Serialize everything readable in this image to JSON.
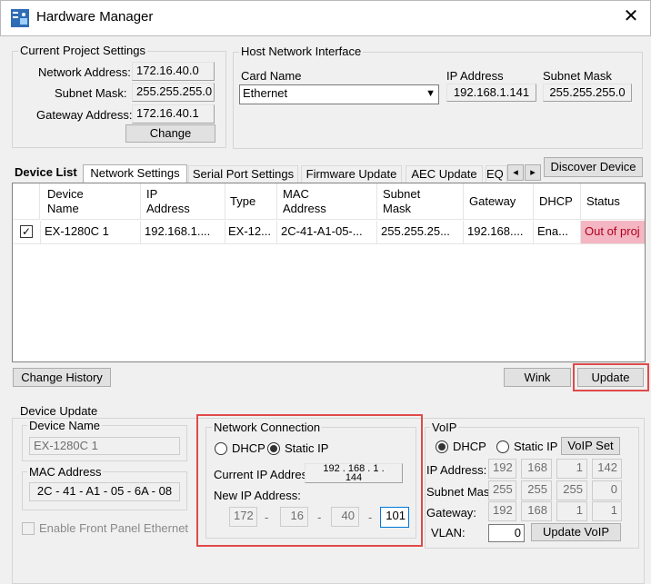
{
  "window": {
    "title": "Hardware Manager",
    "close_glyph": "✕"
  },
  "project_settings": {
    "title": "Current Project Settings",
    "network_address_label": "Network Address:",
    "network_address": "172.16.40.0",
    "subnet_mask_label": "Subnet Mask:",
    "subnet_mask": "255.255.255.0",
    "gateway_label": "Gateway Address:",
    "gateway": "172.16.40.1",
    "change_button": "Change"
  },
  "host_interface": {
    "title": "Host Network Interface",
    "card_name_label": "Card Name",
    "card_name": "Ethernet",
    "ip_label": "IP Address",
    "ip": "192.168.1.141",
    "subnet_label": "Subnet Mask",
    "subnet": "255.255.255.0"
  },
  "device_list": {
    "title": "Device List",
    "tabs": [
      "Network Settings",
      "Serial Port Settings",
      "Firmware Update",
      "AEC Update",
      "EQ"
    ],
    "scroll_left": "◂",
    "scroll_right": "▸",
    "discover_button": "Discover Device",
    "columns": [
      "Device\nName",
      "IP\nAddress",
      "Type",
      "MAC\nAddress",
      "Subnet\nMask",
      "Gateway",
      "DHCP",
      "Status"
    ],
    "rows": [
      {
        "checked": "✓",
        "cells": [
          "EX-1280C 1",
          "192.168.1....",
          "EX-12...",
          "2C-41-A1-05-...",
          "255.255.25...",
          "192.168....",
          "Ena...",
          "Out of proj"
        ]
      }
    ]
  },
  "buttons": {
    "change_history": "Change History",
    "wink": "Wink",
    "update": "Update"
  },
  "device_update": {
    "title": "Device Update",
    "device_name_title": "Device Name",
    "device_name": "EX-1280C 1",
    "mac_title": "MAC Address",
    "mac": "2C - 41 - A1 - 05 - 6A - 08",
    "front_panel_label": "Enable Front Panel Ethernet"
  },
  "network_connection": {
    "title": "Network Connection",
    "dhcp_label": "DHCP",
    "static_label": "Static IP",
    "current_ip_label": "Current IP Addres",
    "current_ip_line1": "192 . 168 . 1 .",
    "current_ip_line2": "144",
    "new_ip_label": "New IP Address:",
    "new_ip": [
      "172",
      "16",
      "40",
      "101"
    ],
    "sep": "-"
  },
  "voip": {
    "title": "VoIP",
    "dhcp_label": "DHCP",
    "static_label": "Static IP",
    "set_button": "VoIP Set",
    "ip_label": "IP Address:",
    "ip": [
      "192",
      "168",
      "1",
      "142"
    ],
    "subnet_label": "Subnet Mas",
    "subnet": [
      "255",
      "255",
      "255",
      "0"
    ],
    "gateway_label": "Gateway:",
    "gateway": [
      "192",
      "168",
      "1",
      "1"
    ],
    "vlan_label": "VLAN:",
    "vlan": "0",
    "update_button": "Update VoIP"
  },
  "colors": {
    "highlight_border": "#e04a4a",
    "status_bg": "#f4b6c2",
    "tab_active": "#ffffff"
  }
}
